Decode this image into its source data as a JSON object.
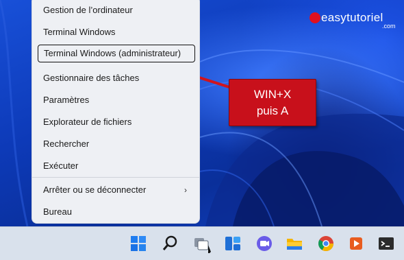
{
  "menu": {
    "items": [
      {
        "label": "Gestion de l’ordinateur"
      },
      {
        "label": "Terminal Windows"
      },
      {
        "label": "Terminal Windows (administrateur)",
        "selected": true
      },
      {
        "label": "Gestionnaire des tâches"
      },
      {
        "label": "Paramètres"
      },
      {
        "label": "Explorateur de fichiers"
      },
      {
        "label": "Rechercher"
      },
      {
        "label": "Exécuter"
      },
      {
        "label": "Arrêter ou se déconnecter",
        "submenu": true
      },
      {
        "label": "Bureau"
      }
    ],
    "chevron": "›"
  },
  "callout": {
    "line1": "WIN+X",
    "line2": "puis A",
    "color": "#c8101b"
  },
  "watermark": {
    "name": "easytutoriel",
    "suffix": ".com"
  },
  "taskbar": {
    "icons": [
      "start-icon",
      "search-icon",
      "task-view-icon",
      "widgets-icon",
      "chat-icon",
      "file-explorer-icon",
      "chrome-icon",
      "media-player-icon",
      "terminal-icon"
    ]
  },
  "colors": {
    "accent_red": "#c8101b",
    "menu_bg": "#eef0f4",
    "taskbar_bg": "#d9e1ec"
  }
}
